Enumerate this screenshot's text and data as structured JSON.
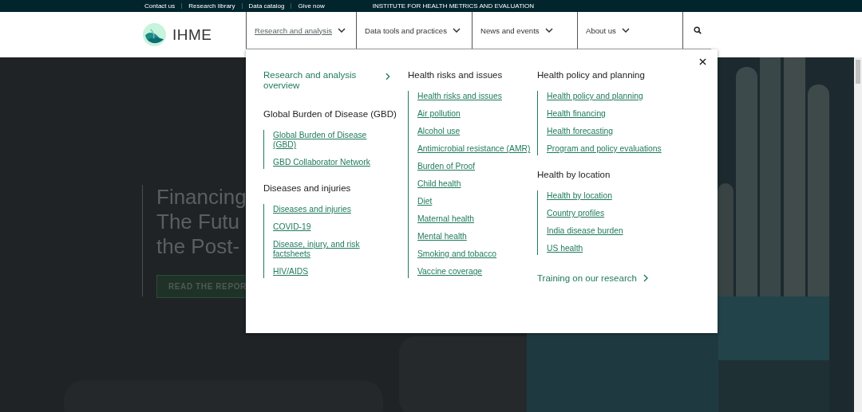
{
  "utility_links": [
    "Contact us",
    "Research library",
    "Data catalog",
    "Give now"
  ],
  "institute_name": "INSTITUTE FOR HEALTH METRICS AND EVALUATION",
  "logo_text": "IHME",
  "nav": [
    {
      "label": "Research and analysis",
      "selected": true
    },
    {
      "label": "Data tools and practices",
      "selected": false
    },
    {
      "label": "News and events",
      "selected": false
    },
    {
      "label": "About us",
      "selected": false
    }
  ],
  "hero": {
    "title_lines": [
      "Financing",
      "The Futu",
      "the Post-"
    ],
    "button": "READ THE REPOR"
  },
  "menu": {
    "columns": [
      [
        {
          "kind": "overview",
          "label": "Research and analysis overview"
        },
        {
          "kind": "group",
          "heading": "Global Burden of Disease (GBD)",
          "links": [
            "Global Burden of Disease (GBD)",
            "GBD Collaborator Network"
          ]
        },
        {
          "kind": "group",
          "heading": "Diseases and injuries",
          "links": [
            "Diseases and injuries",
            "COVID-19",
            "Disease, injury, and risk factsheets",
            "HIV/AIDS"
          ]
        }
      ],
      [
        {
          "kind": "group",
          "heading": "Health risks and issues",
          "links": [
            "Health risks and issues",
            "Air pollution",
            "Alcohol use",
            "Antimicrobial resistance (AMR)",
            "Burden of Proof",
            "Child health",
            "Diet",
            "Maternal health",
            "Mental health",
            "Smoking and tobacco",
            "Vaccine coverage"
          ]
        }
      ],
      [
        {
          "kind": "group",
          "heading": "Health policy and planning",
          "links": [
            "Health policy and planning",
            "Health financing",
            "Health forecasting",
            "Program and policy evaluations"
          ]
        },
        {
          "kind": "group",
          "heading": "Health by location",
          "links": [
            "Health by location",
            "Country profiles",
            "India disease burden",
            "US health"
          ]
        },
        {
          "kind": "cta",
          "label": "Training on our research"
        }
      ]
    ]
  }
}
